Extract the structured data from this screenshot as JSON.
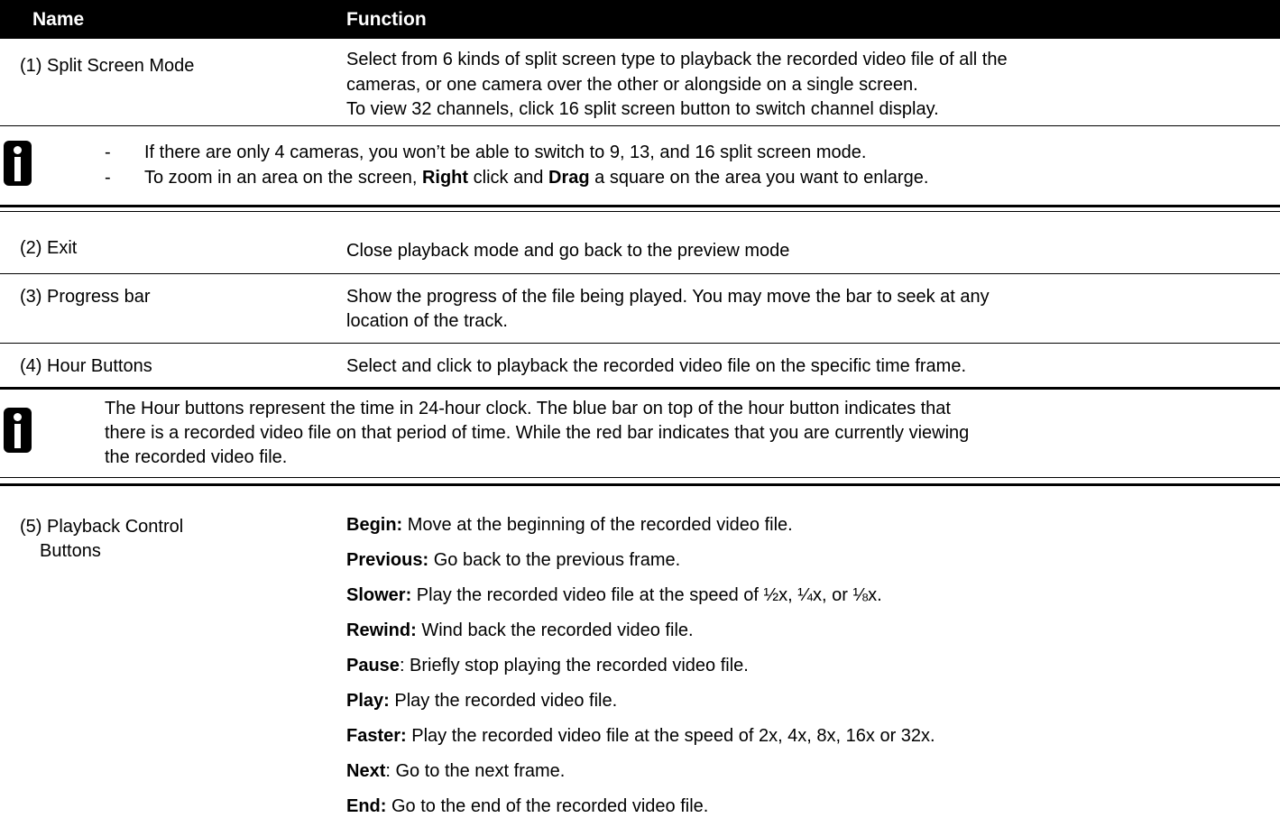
{
  "header": {
    "name": "Name",
    "function": "Function"
  },
  "row1": {
    "name": "(1) Split Screen Mode",
    "lines": [
      "Select from 6 kinds of split screen type to playback the recorded video file of all the",
      "cameras, or one camera over the other or alongside on a single screen.",
      "To view 32 channels, click 16 split screen button to switch channel display."
    ]
  },
  "note1": {
    "line1": "If there are only 4 cameras, you won’t be able to switch to 9, 13, and 16 split screen mode.",
    "line2_a": "To zoom in an area on the screen, ",
    "line2_b": "Right",
    "line2_c": " click and ",
    "line2_d": "Drag",
    "line2_e": " a square on the area you want to enlarge.",
    "dash": "-"
  },
  "row2": {
    "name": "(2) Exit",
    "text": "Close playback mode and go back to the preview mode"
  },
  "row3": {
    "name": "(3) Progress bar",
    "line1": "Show the progress of the file being played. You may move the bar to seek at any",
    "line2": "location of the track."
  },
  "row4": {
    "name": "(4) Hour Buttons",
    "text": "Select and click to playback the recorded video file on the specific time frame."
  },
  "note2": {
    "line1": "The Hour buttons represent the time in 24-hour clock. The blue bar on top of the hour button indicates that",
    "line2": "there is a recorded video file on that period of time. While the red bar indicates that you are currently viewing",
    "line3": "the recorded video file."
  },
  "row5": {
    "name_line1": "(5) Playback Control",
    "name_line2": "Buttons",
    "items": [
      {
        "label": "Begin:",
        "text": " Move at the beginning of the recorded video file."
      },
      {
        "label": "Previous:",
        "text": " Go back to the previous frame."
      },
      {
        "label": "Slower:",
        "text": " Play the recorded video file at the speed of ½x, ¼x, or ⅛x."
      },
      {
        "label": "Rewind:",
        "text": " Wind back the recorded video file."
      },
      {
        "label": "Pause",
        "text": ": Briefly stop playing the recorded video file."
      },
      {
        "label": "Play:",
        "text": " Play the recorded video file."
      },
      {
        "label": "Faster:",
        "text": " Play the recorded video file at the speed of 2x, 4x, 8x, 16x or 32x."
      },
      {
        "label": "Next",
        "text": ": Go to the next frame."
      },
      {
        "label": "End:",
        "text": " Go to the end of the recorded video file."
      }
    ]
  }
}
